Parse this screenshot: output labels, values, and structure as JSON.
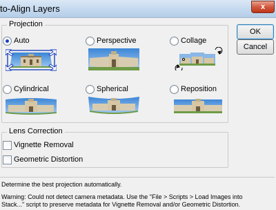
{
  "window": {
    "title": "to-Align Layers",
    "close_glyph": "x"
  },
  "projection": {
    "legend": "Projection",
    "options": [
      {
        "label": "Auto",
        "selected": true
      },
      {
        "label": "Perspective",
        "selected": false
      },
      {
        "label": "Collage",
        "selected": false
      },
      {
        "label": "Cylindrical",
        "selected": false
      },
      {
        "label": "Spherical",
        "selected": false
      },
      {
        "label": "Reposition",
        "selected": false
      }
    ]
  },
  "lens": {
    "legend": "Lens Correction",
    "vignette": "Vignette Removal",
    "geometric": "Geometric Distortion"
  },
  "buttons": {
    "ok": "OK",
    "cancel": "Cancel"
  },
  "description": {
    "line1": "Determine the best projection automatically.",
    "warning1": "Warning: Could not detect camera metadata. Use the \"File > Scripts > Load Images into",
    "warning2": "Stack...\" script to preserve metadata for Vignette Removal and/or Geometric Distortion."
  },
  "colors": {
    "sky": "#5aa0e0",
    "building": "#d6c6a4",
    "roof": "#8a7a5c",
    "lawn": "#6f9b47",
    "selection": "#1b3fbf"
  }
}
